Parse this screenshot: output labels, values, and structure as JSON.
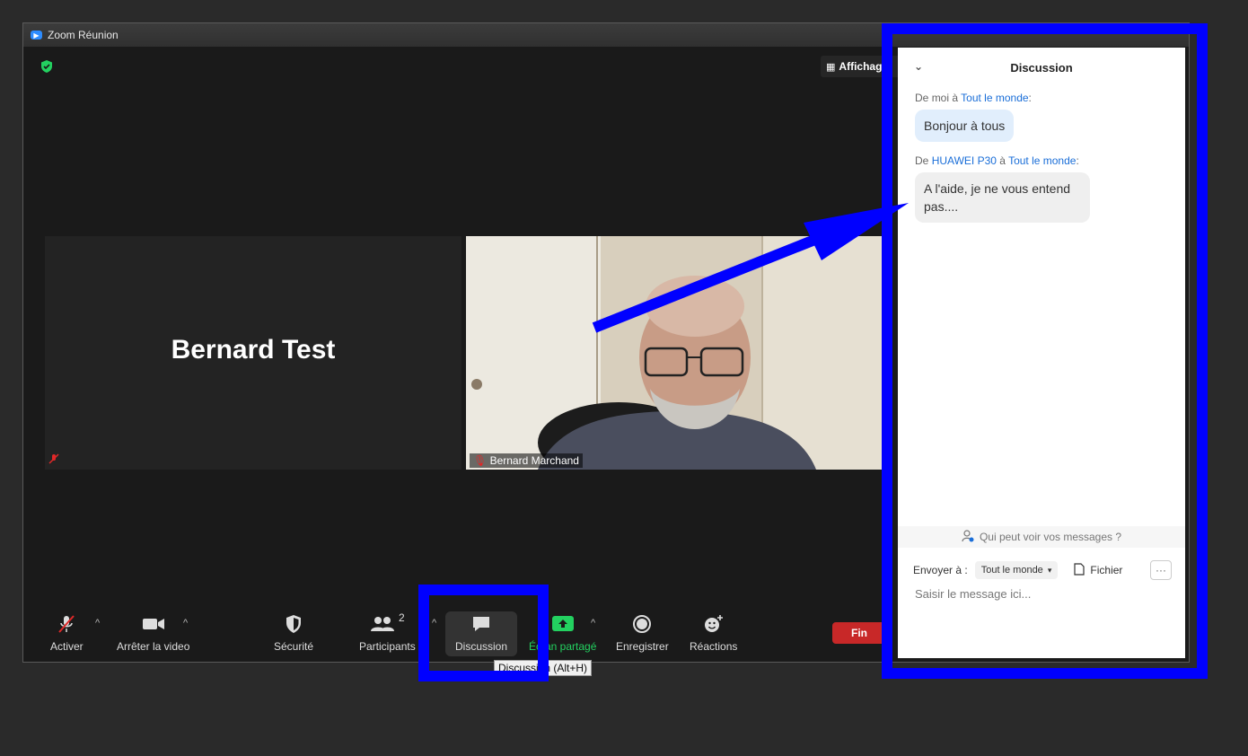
{
  "window": {
    "title": "Zoom Réunion",
    "view_label": "Affichage"
  },
  "participants_tiles": [
    {
      "name": "Bernard Test"
    },
    {
      "name": "Bernard Marchand"
    }
  ],
  "toolbar": {
    "mute_label": "Activer",
    "video_label": "Arrêter la video",
    "security_label": "Sécurité",
    "participants_label": "Participants",
    "participants_count": "2",
    "chat_label": "Discussion",
    "share_label": "Écran partagé",
    "record_label": "Enregistrer",
    "reactions_label": "Réactions",
    "end_label": "Fin",
    "share_color": "#23d160",
    "end_color": "#c82828"
  },
  "tooltip": "Discussion (Alt+H)",
  "chat": {
    "title": "Discussion",
    "messages": [
      {
        "from": "moi",
        "to": "Tout le monde",
        "text": "Bonjour à tous"
      },
      {
        "from": "HUAWEI P30",
        "to": "Tout le monde",
        "text": "A l'aide, je ne vous entend pas...."
      }
    ],
    "who_sees": "Qui peut voir vos messages ?",
    "send_to_label": "Envoyer à :",
    "send_to_value": "Tout le monde",
    "file_label": "Fichier",
    "input_placeholder": "Saisir le message ici..."
  },
  "annotation_color": "#0000ff"
}
